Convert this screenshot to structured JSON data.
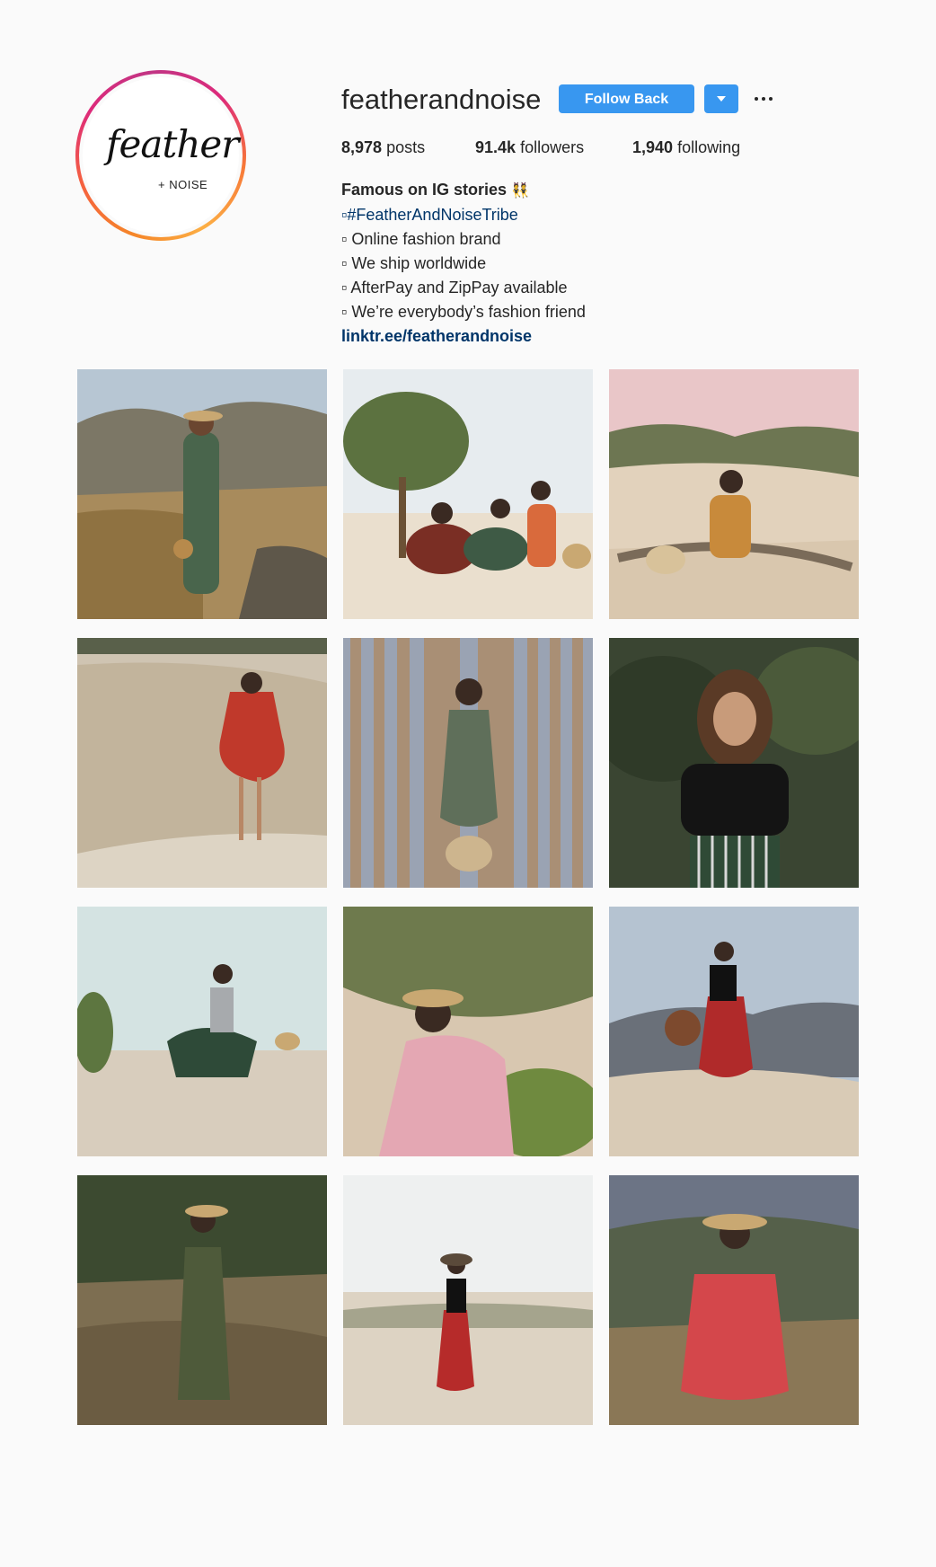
{
  "profile": {
    "username": "featherandnoise",
    "logo_text": "feather",
    "logo_sub": "+ NOISE",
    "follow_label": "Follow Back",
    "stats": {
      "posts_value": "8,978",
      "posts_label": "posts",
      "followers_value": "91.4k",
      "followers_label": "followers",
      "following_value": "1,940",
      "following_label": "following"
    },
    "bio": {
      "name": "Famous on IG stories",
      "name_emoji": "👯",
      "lines": [
        "▫#FeatherAndNoiseTribe",
        "▫ Online fashion brand",
        "▫ We ship worldwide",
        "▫ AfterPay and ZipPay available",
        "▫ We’re everybody’s fashion friend"
      ],
      "link": "linktr.ee/featherandnoise"
    }
  },
  "posts": [
    {
      "subject": "woman in green striped dress with hat by grass path"
    },
    {
      "subject": "three women sitting under tree on sand"
    },
    {
      "subject": "woman sitting on dune at dusk"
    },
    {
      "subject": "woman in red dress on sand dune"
    },
    {
      "subject": "woman in green dress against wooden wall"
    },
    {
      "subject": "woman in black top portrait"
    },
    {
      "subject": "woman twirling green floral skirt on beach"
    },
    {
      "subject": "woman in pink gingham dress on dune"
    },
    {
      "subject": "woman in red skirt holding hat on dune"
    },
    {
      "subject": "woman in olive dress in grass field"
    },
    {
      "subject": "woman in red skirt on sandy field"
    },
    {
      "subject": "woman in red striped dress in field"
    }
  ],
  "colors": {
    "accent": "#3897f0",
    "link": "#003569",
    "background": "#fafafa",
    "text": "#262626"
  }
}
